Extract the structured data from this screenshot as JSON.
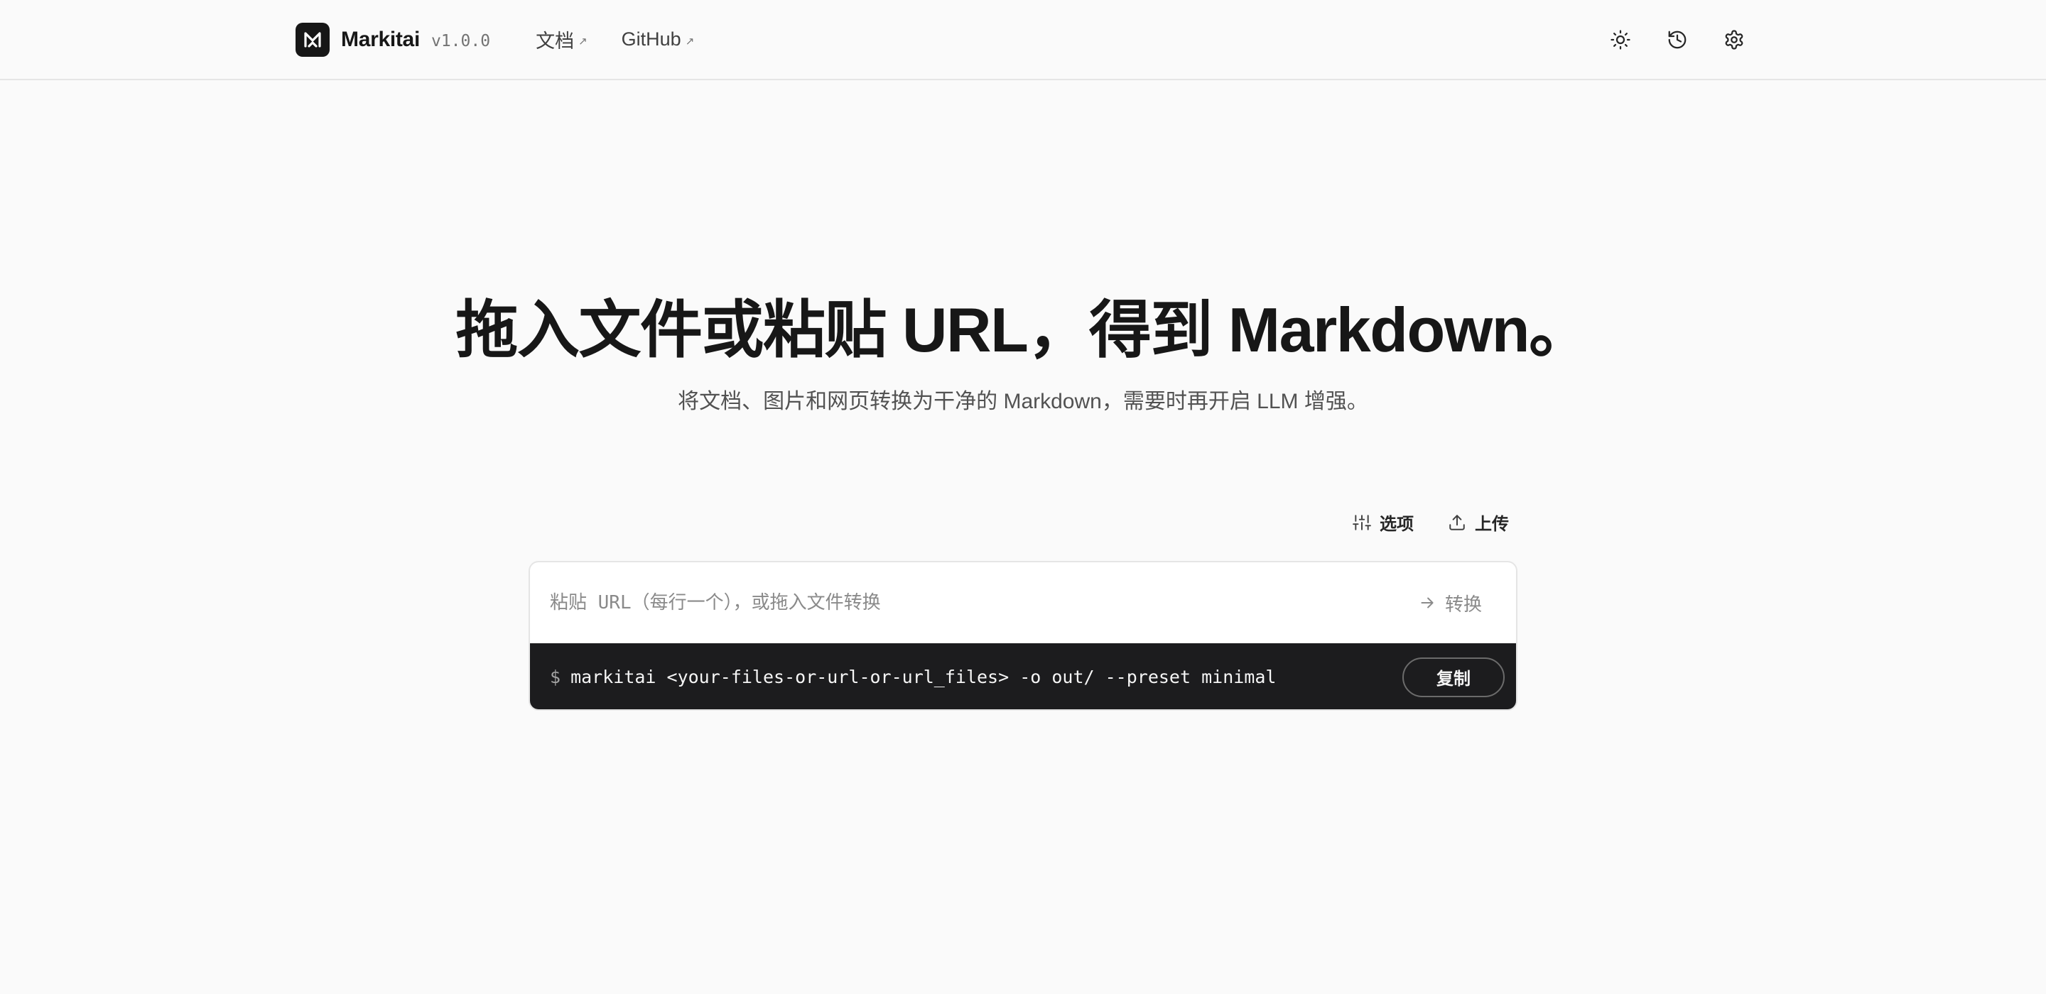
{
  "header": {
    "brand": "Markitai",
    "version": "v1.0.0",
    "nav": [
      {
        "label": "文档",
        "external_icon": "↗"
      },
      {
        "label": "GitHub",
        "external_icon": "↗"
      }
    ],
    "icons": [
      "sun-icon",
      "history-icon",
      "gear-icon"
    ]
  },
  "hero": {
    "title": "拖入文件或粘贴 URL，得到 Markdown。",
    "subtitle": "将文档、图片和网页转换为干净的 Markdown，需要时再开启 LLM 增强。"
  },
  "toolbar": {
    "options_label": "选项",
    "upload_label": "上传"
  },
  "input": {
    "placeholder": "粘贴 URL（每行一个），或拖入文件转换",
    "value": "",
    "convert_label": "转换"
  },
  "command": {
    "prompt": "$",
    "text": "markitai <your-files-or-url-or-url_files> -o out/ --preset minimal",
    "copy_label": "复制"
  },
  "colors": {
    "background": "#fafafa",
    "text": "#171717",
    "command_bg": "#1c1c1e",
    "border": "#e5e5e5"
  }
}
